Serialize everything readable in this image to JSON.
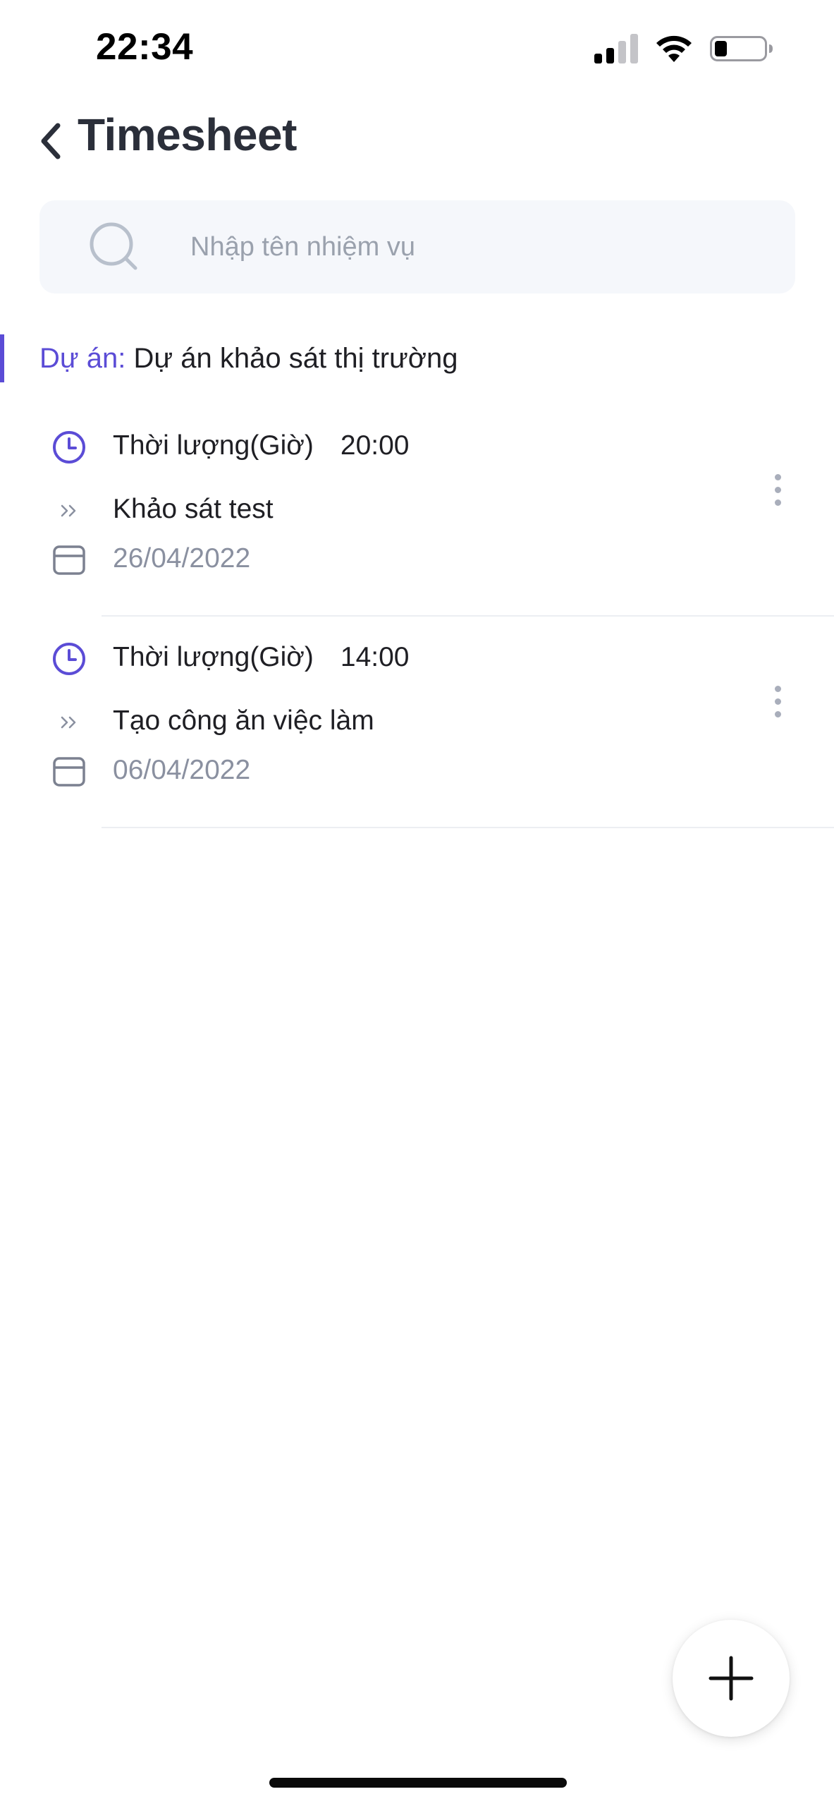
{
  "status_bar": {
    "time": "22:34",
    "icons": [
      "cellular-signal-icon",
      "wifi-icon",
      "battery-icon"
    ]
  },
  "header": {
    "back_icon": "chevron-left-icon",
    "title": "Timesheet"
  },
  "search": {
    "placeholder": "Nhập tên nhiệm vụ",
    "value": "",
    "icon": "search-icon"
  },
  "project": {
    "label": "Dự án:",
    "name": "Dự án khảo sát thị trường"
  },
  "entries": [
    {
      "duration_label": "Thời lượng(Giờ)",
      "duration_value": "20:00",
      "task": "Khảo sát test",
      "date": "26/04/2022"
    },
    {
      "duration_label": "Thời lượng(Giờ)",
      "duration_value": "14:00",
      "task": "Tạo công ăn việc làm",
      "date": "06/04/2022"
    }
  ],
  "fab": {
    "icon": "plus-icon"
  },
  "colors": {
    "accent": "#5b4cd6",
    "title": "#2b2f3a",
    "muted": "#8a90a0",
    "search_bg": "#f5f7fb",
    "divider": "#eceef2"
  }
}
